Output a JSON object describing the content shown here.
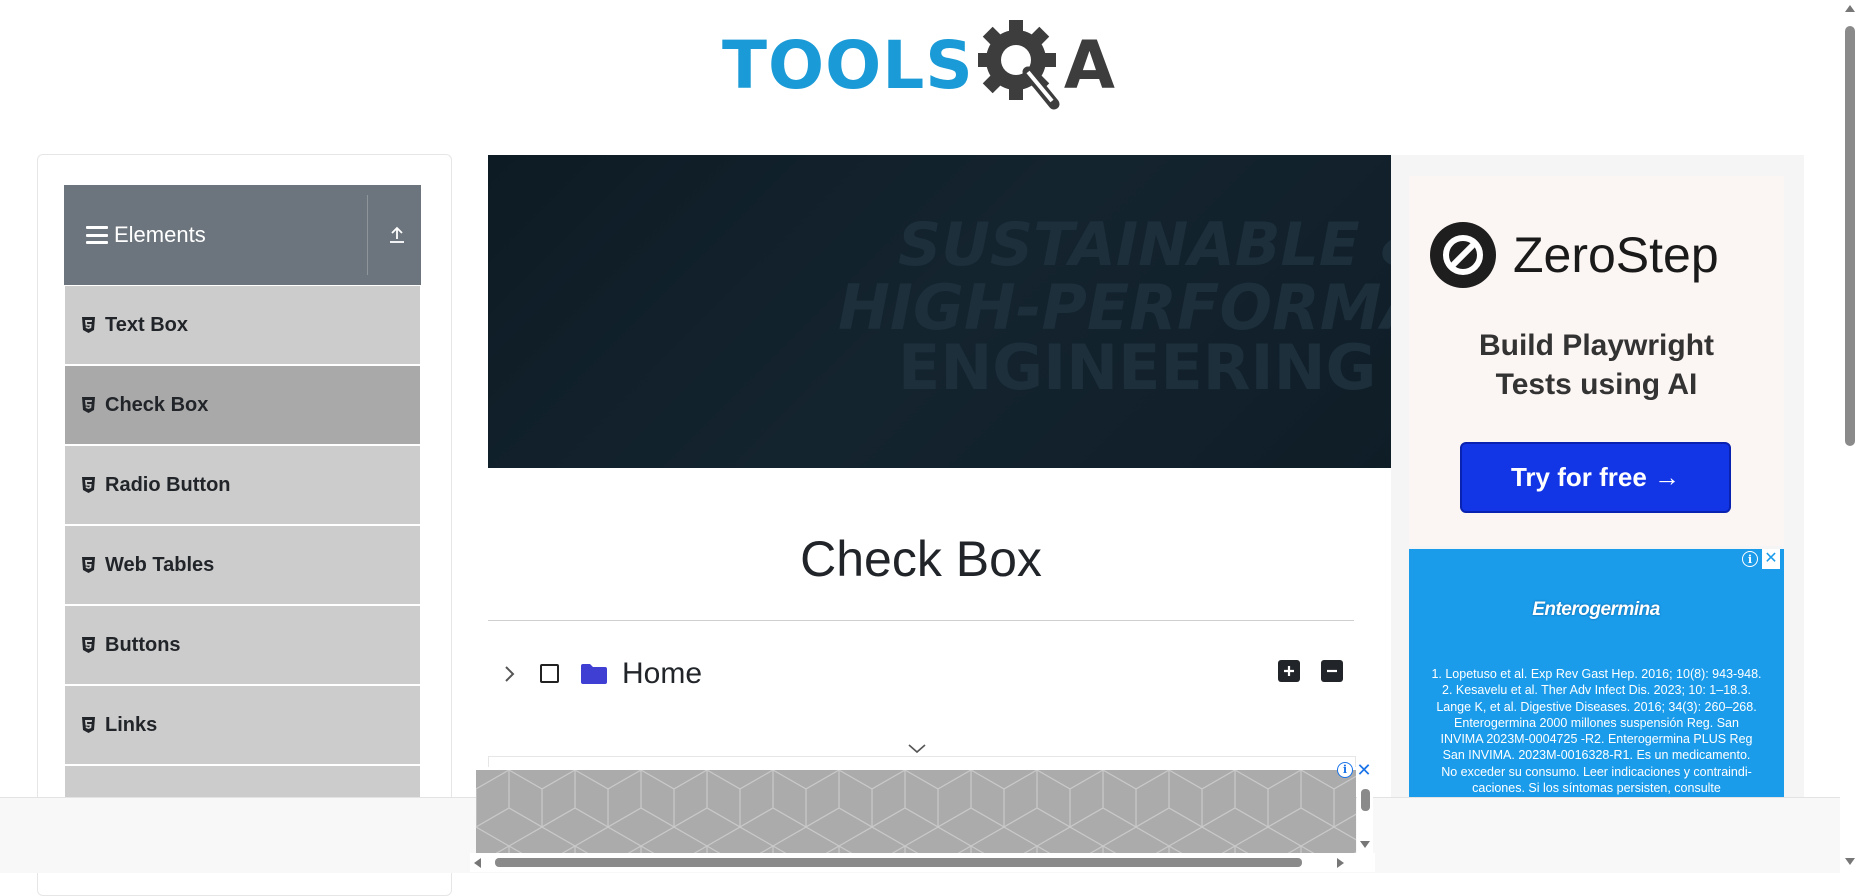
{
  "logo": {
    "part1": "TOOLS",
    "part2": "A"
  },
  "sidebar": {
    "group_title": "Elements",
    "items": [
      {
        "label": "Text Box"
      },
      {
        "label": "Check Box"
      },
      {
        "label": "Radio Button"
      },
      {
        "label": "Web Tables"
      },
      {
        "label": "Buttons"
      },
      {
        "label": "Links"
      }
    ],
    "active_index": 1
  },
  "banner": {
    "line1": "SUSTAINABLE &",
    "line2": "HIGH-PERFORMANCE",
    "line3": "ENGINEERING MATERIA"
  },
  "main": {
    "title": "Check Box",
    "tree": {
      "root_label": "Home"
    }
  },
  "ads": {
    "zerostep": {
      "brand": "ZeroStep",
      "tagline_line1": "Build Playwright",
      "tagline_line2": "Tests using AI",
      "cta": "Try for free →"
    },
    "enterogermina": {
      "brand": "Enterogermina",
      "info": "i",
      "close": "✕",
      "lines": [
        "1. Lopetuso et al. Exp Rev Gast Hep. 2016; 10(8): 943-948.",
        "2. Kesavelu et al. Ther Adv Infect Dis. 2023; 10: 1–18.3.",
        "Lange K, et al. Digestive Diseases. 2016; 34(3): 260–268.",
        "Enterogermina 2000 millones suspensión Reg. San",
        "INVIMA 2023M-0004725 -R2. Enterogermina PLUS Reg",
        "San INVIMA. 2023M-0016328-R1. Es un medicamento.",
        "No exceder su consumo. Leer indicaciones y contraindi-",
        "caciones. Si los síntomas persisten, consulte"
      ]
    },
    "bottom": {
      "info": "i",
      "close": "✕"
    }
  },
  "colors": {
    "logo_blue": "#1a9bd7",
    "group_header": "#6c757d",
    "menu_item": "#cccccc",
    "menu_item_active": "#a9a9a9",
    "folder": "#3f3fd3",
    "zerostep_cta": "#1235e6",
    "enterogermina_bg": "#1a9ceb"
  }
}
